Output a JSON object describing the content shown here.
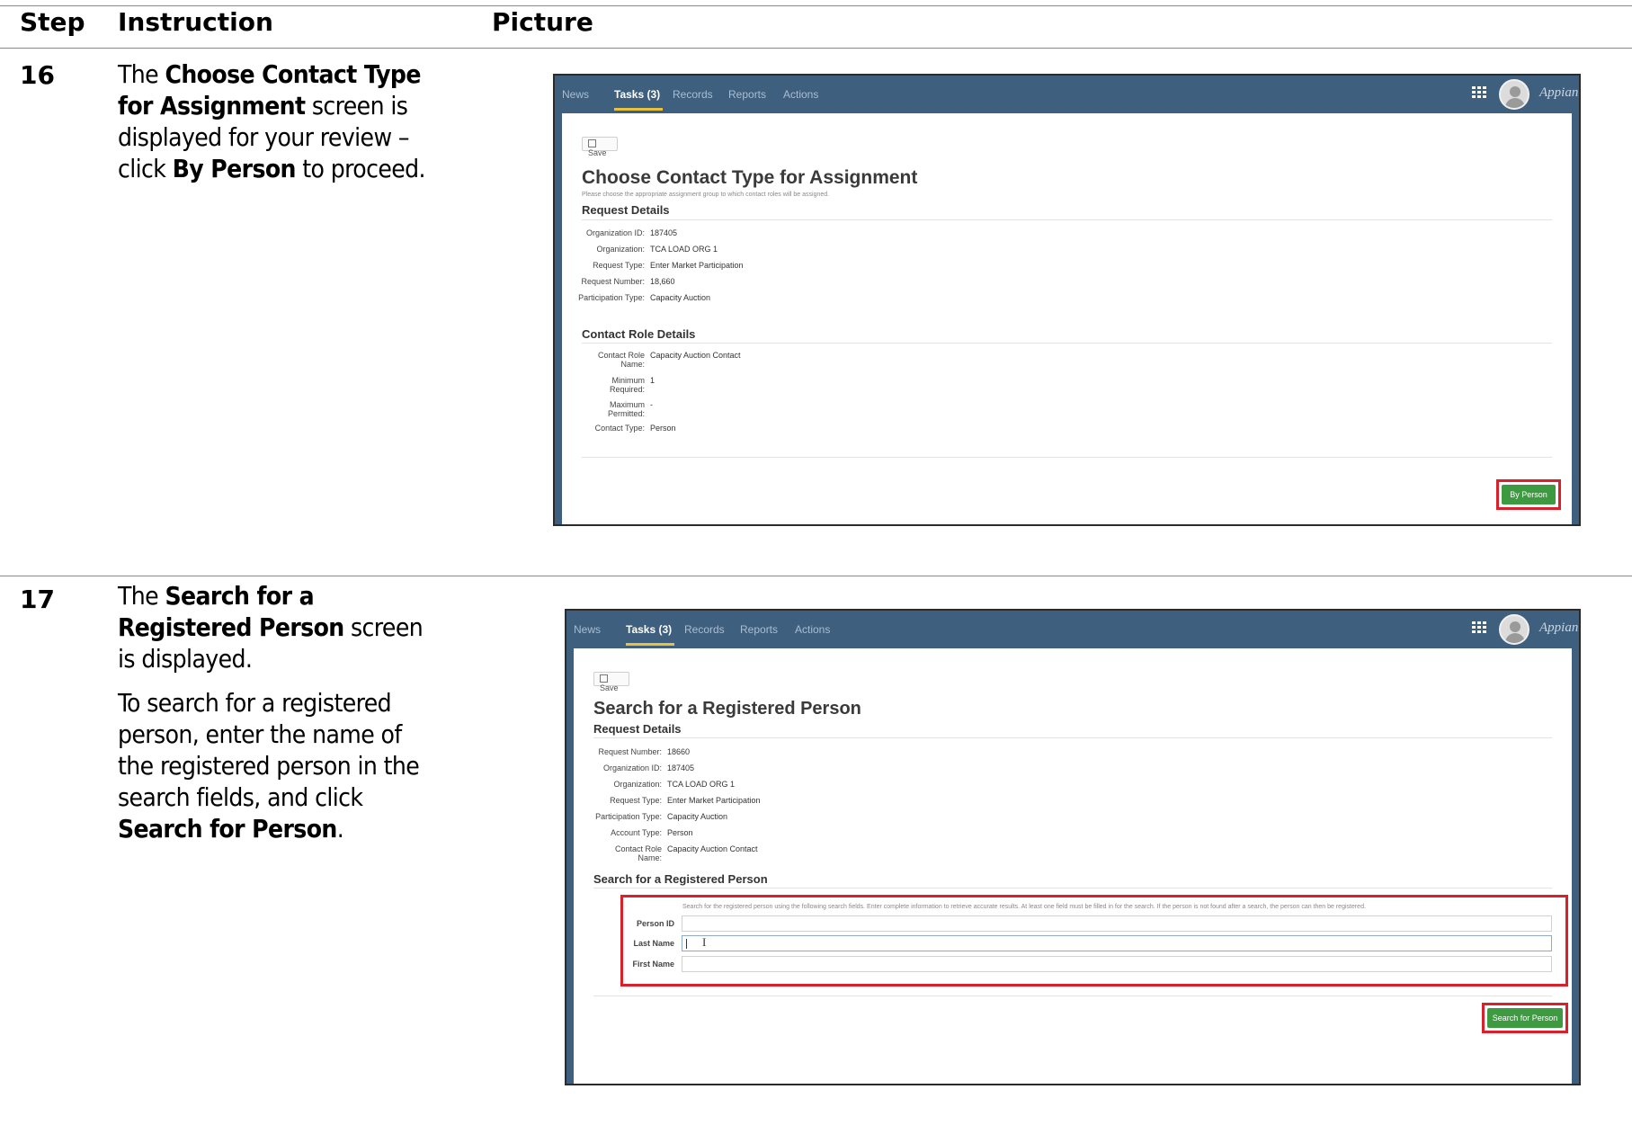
{
  "table": {
    "headers": {
      "step": "Step",
      "instruction": "Instruction",
      "picture": "Picture"
    }
  },
  "rows": [
    {
      "step": "16",
      "instruction": {
        "lines": [
          {
            "parts": [
              {
                "t": "The ",
                "b": false
              },
              {
                "t": "Choose Contact Type",
                "b": true
              }
            ]
          },
          {
            "parts": [
              {
                "t": "for Assignment",
                "b": true
              },
              {
                "t": " screen is",
                "b": false
              }
            ]
          },
          {
            "parts": [
              {
                "t": "displayed for your review –",
                "b": false
              }
            ]
          },
          {
            "parts": [
              {
                "t": "click ",
                "b": false
              },
              {
                "t": "By Person",
                "b": true
              },
              {
                "t": " to proceed.",
                "b": false
              }
            ]
          }
        ]
      },
      "screenshot": {
        "nav": {
          "tabs": [
            "News",
            "Tasks (3)",
            "Records",
            "Reports",
            "Actions"
          ],
          "active_tab": "Tasks (3)",
          "brand": "Appian",
          "menu_icon": "grid-icon",
          "avatar_icon": "user-avatar-icon"
        },
        "save_label": "Save",
        "title": "Choose Contact Type for Assignment",
        "subtitle": "Please choose the appropriate assignment group to which contact roles will be assigned.",
        "request_details_heading": "Request Details",
        "request_fields": [
          {
            "label": "Organization ID:",
            "value": "187405"
          },
          {
            "label": "Organization:",
            "value": "TCA LOAD ORG 1"
          },
          {
            "label": "Request Type:",
            "value": "Enter Market Participation"
          },
          {
            "label": "Request Number:",
            "value": "18,660"
          },
          {
            "label": "Participation Type:",
            "value": "Capacity Auction"
          }
        ],
        "contact_heading": "Contact Role Details",
        "contact_fields": [
          {
            "label1": "Contact Role",
            "label2": "Name:",
            "value": "Capacity Auction Contact"
          },
          {
            "label1": "Minimum",
            "label2": "Required:",
            "value": "1"
          },
          {
            "label1": "Maximum",
            "label2": "Permitted:",
            "value": "-"
          },
          {
            "label1": "Contact Type:",
            "label2": "",
            "value": "Person"
          }
        ],
        "action_button": "By Person",
        "highlight_color": "#d9202b",
        "button_color": "#3e9a41",
        "nav_color": "#3f5f7e"
      }
    },
    {
      "step": "17",
      "instruction": {
        "paragraphs": [
          [
            {
              "parts": [
                {
                  "t": "The ",
                  "b": false
                },
                {
                  "t": "Search for a",
                  "b": true
                }
              ]
            },
            {
              "parts": [
                {
                  "t": "Registered Person",
                  "b": true
                },
                {
                  "t": " screen",
                  "b": false
                }
              ]
            },
            {
              "parts": [
                {
                  "t": "is displayed.",
                  "b": false
                }
              ]
            }
          ],
          [
            {
              "parts": [
                {
                  "t": "To search for a registered",
                  "b": false
                }
              ]
            },
            {
              "parts": [
                {
                  "t": "person, enter the name of",
                  "b": false
                }
              ]
            },
            {
              "parts": [
                {
                  "t": "the registered person in the",
                  "b": false
                }
              ]
            },
            {
              "parts": [
                {
                  "t": "search fields, and click",
                  "b": false
                }
              ]
            },
            {
              "parts": [
                {
                  "t": "Search for Person",
                  "b": true
                },
                {
                  "t": ".",
                  "b": false
                }
              ]
            }
          ]
        ]
      },
      "screenshot": {
        "nav": {
          "tabs": [
            "News",
            "Tasks (3)",
            "Records",
            "Reports",
            "Actions"
          ],
          "active_tab": "Tasks (3)",
          "brand": "Appian"
        },
        "save_label": "Save",
        "title": "Search for a Registered Person",
        "request_details_heading": "Request Details",
        "request_fields": [
          {
            "label1": "Request Number:",
            "label2": "",
            "value": "18660"
          },
          {
            "label1": "Organization ID:",
            "label2": "",
            "value": "187405"
          },
          {
            "label1": "Organization:",
            "label2": "",
            "value": "TCA LOAD ORG 1"
          },
          {
            "label1": "Request Type:",
            "label2": "",
            "value": "Enter Market Participation"
          },
          {
            "label1": "Participation Type:",
            "label2": "",
            "value": "Capacity Auction"
          },
          {
            "label1": "Account Type:",
            "label2": "",
            "value": "Person"
          },
          {
            "label1": "Contact Role",
            "label2": "Name:",
            "value": "Capacity Auction Contact"
          }
        ],
        "search_heading": "Search for a Registered Person",
        "search_help": "Search for the registered person using the following search fields. Enter complete information to retrieve accurate results. At least one field must be filled in for the search. If the person is not found after a search, the person can then be registered.",
        "search_fields": [
          {
            "label": "Person ID",
            "value": ""
          },
          {
            "label": "Last Name",
            "value": ""
          },
          {
            "label": "First Name",
            "value": ""
          }
        ],
        "action_button": "Search for Person"
      }
    }
  ]
}
